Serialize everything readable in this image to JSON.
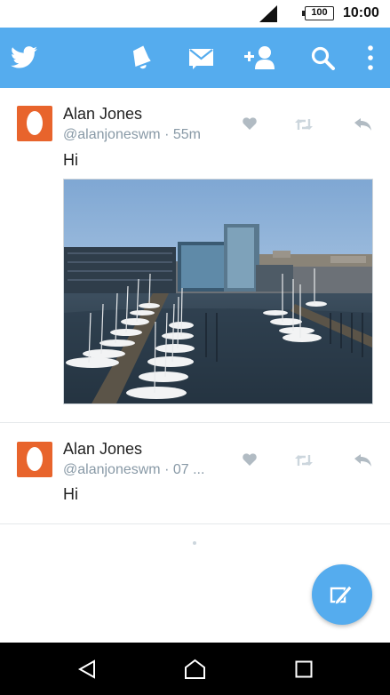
{
  "status_bar": {
    "battery": "100",
    "time": "10:00",
    "icons": [
      "signal-icon",
      "battery-icon"
    ]
  },
  "app_bar": {
    "icons": [
      "twitter-bird-icon",
      "notifications-bell-icon",
      "messages-envelope-icon",
      "add-user-icon",
      "search-icon",
      "overflow-menu-icon"
    ],
    "color": "#55acee"
  },
  "timeline": {
    "tweets": [
      {
        "name": "Alan Jones",
        "handle": "@alanjoneswm · 55m",
        "text": "Hi",
        "has_media": true,
        "actions": [
          "favorite-icon",
          "retweet-icon",
          "reply-icon"
        ]
      },
      {
        "name": "Alan Jones",
        "handle": "@alanjoneswm · 07 ...",
        "text": "Hi",
        "has_media": false,
        "actions": [
          "favorite-icon",
          "retweet-icon",
          "reply-icon"
        ]
      }
    ]
  },
  "fab": {
    "icon": "compose-tweet-icon"
  },
  "nav_bar": {
    "icons": [
      "back-icon",
      "home-icon",
      "recents-icon"
    ]
  }
}
